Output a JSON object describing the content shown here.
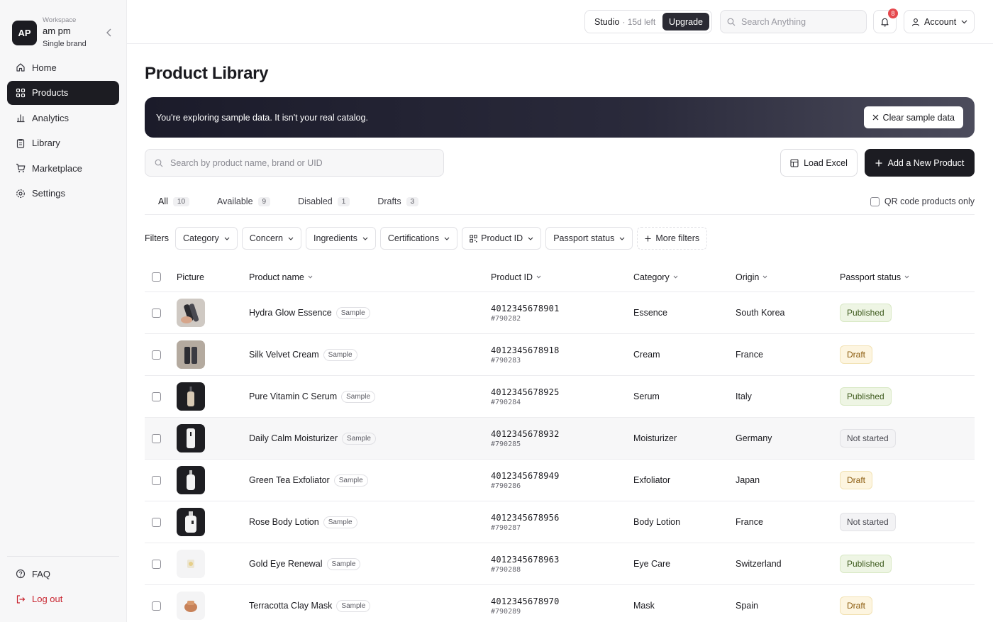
{
  "sidebar": {
    "workspace_caption": "Workspace",
    "avatar_initials": "AP",
    "workspace_name": "am pm",
    "workspace_type": "Single brand",
    "items": [
      {
        "label": "Home",
        "icon": "home-icon"
      },
      {
        "label": "Products",
        "icon": "grid-icon"
      },
      {
        "label": "Analytics",
        "icon": "bar-chart-icon"
      },
      {
        "label": "Library",
        "icon": "clipboard-icon"
      },
      {
        "label": "Marketplace",
        "icon": "cart-icon"
      },
      {
        "label": "Settings",
        "icon": "gear-icon"
      }
    ],
    "active_item": "Products",
    "bottom_items": [
      {
        "label": "FAQ",
        "icon": "help-icon"
      },
      {
        "label": "Log out",
        "icon": "logout-icon"
      }
    ]
  },
  "topbar": {
    "plan_name": "Studio",
    "plan_remaining": "· 15d left",
    "upgrade_label": "Upgrade",
    "search_placeholder": "Search Anything",
    "notification_count": "8",
    "account_label": "Account"
  },
  "page": {
    "title": "Product Library",
    "banner_text": "You're exploring sample data. It isn't your real catalog.",
    "clear_sample_label": "Clear sample data",
    "search_placeholder": "Search by product name, brand or UID",
    "load_excel_label": "Load Excel",
    "add_product_label": "Add a New Product"
  },
  "tabs": [
    {
      "label": "All",
      "count": "10"
    },
    {
      "label": "Available",
      "count": "9"
    },
    {
      "label": "Disabled",
      "count": "1"
    },
    {
      "label": "Drafts",
      "count": "3"
    }
  ],
  "qr_only_label": "QR code products only",
  "filters": {
    "label": "Filters",
    "items": [
      "Category",
      "Concern",
      "Ingredients",
      "Certifications",
      "Product ID",
      "Passport status"
    ],
    "more_label": "More filters"
  },
  "table": {
    "columns": [
      "Picture",
      "Product name",
      "Product ID",
      "Category",
      "Origin",
      "Passport status"
    ],
    "sample_label": "Sample",
    "rows": [
      {
        "name": "Hydra Glow Essence",
        "product_id": "4012345678901",
        "uid": "#790282",
        "category": "Essence",
        "origin": "South Korea",
        "status": "Published"
      },
      {
        "name": "Silk Velvet Cream",
        "product_id": "4012345678918",
        "uid": "#790283",
        "category": "Cream",
        "origin": "France",
        "status": "Draft"
      },
      {
        "name": "Pure Vitamin C Serum",
        "product_id": "4012345678925",
        "uid": "#790284",
        "category": "Serum",
        "origin": "Italy",
        "status": "Published"
      },
      {
        "name": "Daily Calm Moisturizer",
        "product_id": "4012345678932",
        "uid": "#790285",
        "category": "Moisturizer",
        "origin": "Germany",
        "status": "Not started"
      },
      {
        "name": "Green Tea Exfoliator",
        "product_id": "4012345678949",
        "uid": "#790286",
        "category": "Exfoliator",
        "origin": "Japan",
        "status": "Draft"
      },
      {
        "name": "Rose Body Lotion",
        "product_id": "4012345678956",
        "uid": "#790287",
        "category": "Body Lotion",
        "origin": "France",
        "status": "Not started"
      },
      {
        "name": "Gold Eye Renewal",
        "product_id": "4012345678963",
        "uid": "#790288",
        "category": "Eye Care",
        "origin": "Switzerland",
        "status": "Published"
      },
      {
        "name": "Terracotta Clay Mask",
        "product_id": "4012345678970",
        "uid": "#790289",
        "category": "Mask",
        "origin": "Spain",
        "status": "Draft"
      }
    ]
  },
  "colors": {
    "accent_dark": "#1c1c22",
    "published_bg": "#eef5e4",
    "draft_bg": "#fdf5e0",
    "notstarted_bg": "#f3f3f5",
    "logout_red": "#c8242f",
    "badge_red": "#e5484d"
  }
}
